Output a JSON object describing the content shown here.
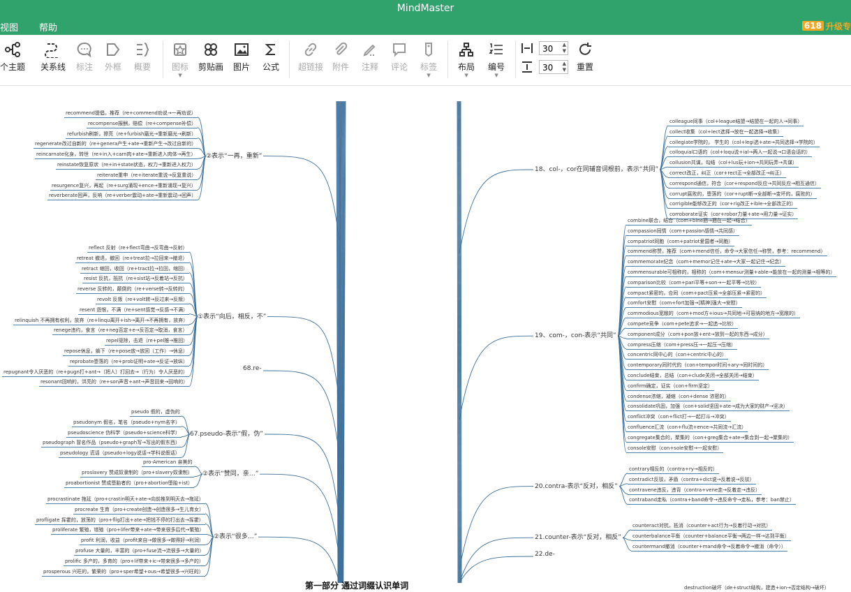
{
  "app": {
    "title": "MindMaster"
  },
  "menu": {
    "items": [
      "视图",
      "帮助"
    ],
    "promo_badge": "618",
    "promo_text": "升级专"
  },
  "toolbar": {
    "items": [
      {
        "label": "个主题",
        "icon": "sub-topic-icon",
        "enabled": true
      },
      {
        "label": "关系线",
        "icon": "relation-line-icon",
        "enabled": true
      },
      {
        "label": "标注",
        "icon": "callout-icon",
        "enabled": false
      },
      {
        "label": "外框",
        "icon": "boundary-icon",
        "enabled": false
      },
      {
        "label": "概要",
        "icon": "summary-icon",
        "enabled": false
      },
      {
        "label": "图标",
        "icon": "icon-icon",
        "enabled": false
      },
      {
        "label": "剪贴画",
        "icon": "clipart-icon",
        "enabled": true
      },
      {
        "label": "图片",
        "icon": "image-icon",
        "enabled": true
      },
      {
        "label": "公式",
        "icon": "formula-icon",
        "enabled": true
      },
      {
        "label": "超链接",
        "icon": "hyperlink-icon",
        "enabled": false
      },
      {
        "label": "附件",
        "icon": "attachment-icon",
        "enabled": false
      },
      {
        "label": "注释",
        "icon": "note-icon",
        "enabled": false
      },
      {
        "label": "评论",
        "icon": "comment-icon",
        "enabled": false
      },
      {
        "label": "标签",
        "icon": "tag-icon",
        "enabled": false
      },
      {
        "label": "布局",
        "icon": "layout-icon",
        "enabled": true
      },
      {
        "label": "编号",
        "icon": "numbering-icon",
        "enabled": true
      },
      {
        "label": "重置",
        "icon": "reset-icon",
        "enabled": true
      }
    ],
    "spacing_h": "30",
    "spacing_v": "30"
  },
  "mindmap": {
    "central_topic": "第一部分 通过词缀认识单词",
    "left_branches": [
      {
        "label": "②表示“一再，重新”",
        "children": [
          "recommend提倡，推荐（re+commend劝说→一再劝说）",
          "recompense报酬，赔偿（re+compense补偿）",
          "refurbish刷新，擦亮（re+furbish磨光→重新磨光→刷新）",
          "regenerate改过自新的（re+genera产生+ate→重新产生→改过自新的）",
          "reincarnate化身，转世（re+in入+carn肉+ate→重新进入肉体→再生）",
          "reinstate恢复原状（re+in+state状态，权力→重新进入权力）",
          "reiterate重申（re+iterate重说→反复重说）",
          "resurgence复兴，再起（re+surg涌现+ence→重新涌现→复兴）",
          "reverberate回声，反响（re+verber震动+ate→重新震动→回声）"
        ]
      },
      {
        "label": "①表示“向后，相反，不”",
        "children": [
          "reflect 反射（re+flect弯曲→反弯曲→反射）",
          "retreat 撤退，撤回（re+treat拉→拉回来→撤退）",
          "retract 缩回，收回（re+tract拉→拉回，缩回）",
          "resist 反抗，抵抗（re+sist站→反着站→反抗）",
          "reverse 反转的，颠倒的（re+verse转→反转的）",
          "revolt 反叛（re+volt转→反过来→反叛）",
          "resent 怨恨，不满（re+sent感觉→反感→不满）",
          "relinquish 不再拥有权利，放弃（re+linqu离开+ish→离开→不再拥有，放弃）",
          "renege违约，食言（re+neg否定+e→反否定→取消，食言）",
          "repel驱除，击退（re+pel推→推回）",
          "repose休息，躺下（re+pose放→放回（工作）→休息）",
          "reprobate堕落的（re+prob证明+ate→反证→放纵）",
          "repugnant令人厌恶的（re+pugn打+ant→〔把人〕打回去→（行为）令人厌恶的）",
          "resonant回响的，洪亮的（re+son声音+ant→声音回来→回响的）"
        ]
      },
      {
        "label": "68.re-",
        "children": []
      },
      {
        "label": "67.pseudo-表示“假，伪”",
        "children": [
          "pseudo 假的，虚伪的",
          "pseudonym 假名，笔名（pseudo+nym名字）",
          "pseudoscience 伪科学（pseudo+science科学）",
          "pseudograph 冒名作品（pseudo+graph写→写出的假东西）",
          "pseudology 谎话（pseudo+logy说话→学科说假话）"
        ]
      },
      {
        "label": "②表示“赞同，亲…”",
        "children": [
          "pro-American 亲美的",
          "proslavery 赞成奴隶制的（pro+slavery奴隶制）",
          "proabortionist 赞成堕胎者的（pro+abortion堕胎+ist）"
        ]
      },
      {
        "label": "②表示“很多…”",
        "children": [
          "procrastinate 拖延（pro+crastin明天+ate→向前推到明天去→拖延）",
          "procreate 生育（pro+create创造→创造很多→生儿育女）",
          "profligate 挥霍的，放荡的（pro+flig打出+ate→把钱不停的打出去→挥霍）",
          "proliferate 繁殖，增殖（pro+lifer带来+ate→带来很多后代→繁殖）",
          "profit 利润，收益（profit来自→做很多→做得好→利润）",
          "profuse 大量的，丰富的（pro+fuse流→流很多→大量的）",
          "prolific 多产的，多育的（pro+lif带来+ic→带来很多→多产的）",
          "prosperous 兴旺的，繁荣的（pro+sper希望+ous→希望很多→兴旺的）"
        ]
      }
    ],
    "right_branches": [
      {
        "label": "18、col-，cor在同辅音词根前，表示“共同”",
        "children": [
          "colleague同事（col+league结盟→结盟在一起的人→同事）",
          "collect收集（col+lect选择→放在一起选择→收集）",
          "collegiate学院的， 学生的（col+legi选+ate→共同选择→学院的）",
          "colloquial口语的（col+loqu说+ial→两人一起说→口语会话的）",
          "collusion共谋，勾结（col+lus玩+ion→共同玩弄→共谋）",
          "correct改正，纠正（cor+rect正→全部改正→纠正）",
          "correspond通信，符合（cor+respond反应→共同反应→相互通信）",
          "corrupt腐败的，堕落的（cor+rupt断→全部断→变坏的，腐败的）",
          "corrigible能够改正的（cor+rig改正+ible→全部改正的）",
          "corroborate证实（cor+robor力量+ate→用力量→证实）"
        ]
      },
      {
        "label": "19、com-，con-表示“共同”",
        "children": [
          "combine联合，结合（com+bine捆→捆在一起→结合）",
          "compassion同情（com+passion感情→共同感）",
          "compatriot同胞（com+patriot爱国者→同胞）",
          "commend称赞，推荐（com+mend信任，命令→大家信任→称赞，参考：recommend）",
          "commemorate纪念（com+memor记住+ate→大家一起记住→纪念）",
          "commensurable可相称的，相称的（com+mensur测量+able→能放在一起的测量→相等的）",
          "comparison比较（com+pari平等+son→一起平等→比较）",
          "compact紧密的，合同（com+pact压紧→全部压紧→紧密的）",
          "comfort安慰（com+fort加强→[精神]强大→安慰）",
          "commodious宽敞的（com+mod方+ious→共同地→可容纳的地方→宽敞的）",
          "compete竞争（com+pete追求→一起追→比较）",
          "component成分（com+pon放+ent→放到一起的东西→成分）",
          "compress压缩（com+press压→一起压→压缩）",
          "concentric同中心的（con+centric中心的）",
          "contemporary同时代的（con+tempor时间+ary→同时间的）",
          "conclude结束，总结（con+clude关闭→全部关闭→结束）",
          "confirm确定，证实（con+firm坚定）",
          "condense浓缩，凝缩（con+dense 浓密的）",
          "consolidate巩固，加强（con+solid坚固+ate→成为大家的财产→坚决）",
          "conflict冲突（con+flict打→一起打斗→冲突）",
          "confluence汇流（con+flu流+ence→共同流→汇流）",
          "congregate集合的，聚集的（con+greg集合+ate→集合到一起→聚集的）",
          "console安慰（con+sole安慰→一起安慰）"
        ]
      },
      {
        "label": "20.contra-表示“反对，相反”",
        "children": [
          "contrary相反的（contra+ry→相反的）",
          "contradict反驳，矛盾（contra+dict说→反着说→反驳）",
          "contravene违反，违背（contra+vene走→反着走→违反）",
          "contraband走私（contra+band命令→违反命令→走私，参考：ban禁止）"
        ]
      },
      {
        "label": "21.counter-表示“反对，相反”",
        "children": [
          "counteract对抗，抵消（counter+act行为→反着行动→对抗）",
          "counterbalance平衡（counter+balance平衡→两边一样→达到平衡）",
          "countermand撤消（counter+mand命令→反着命令→撤消（命令））"
        ]
      },
      {
        "label": "22.de-",
        "children": []
      }
    ],
    "bottom_right_text": "destruction破坏（de+struct结构，建造+ion→否定结构→破坏）"
  }
}
